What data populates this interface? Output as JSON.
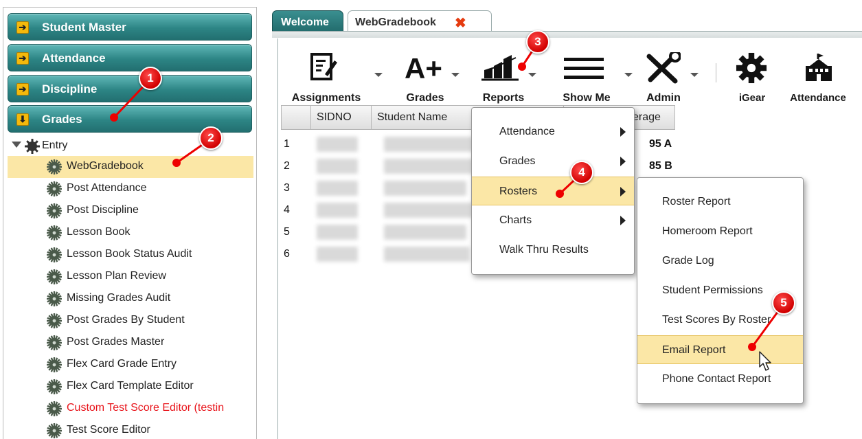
{
  "left_panel": {
    "modules": [
      {
        "label": "Student Master",
        "icon": "arrow-right-icon"
      },
      {
        "label": "Attendance",
        "icon": "arrow-right-icon"
      },
      {
        "label": "Discipline",
        "icon": "arrow-right-icon"
      },
      {
        "label": "Grades",
        "icon": "arrow-down-icon"
      }
    ],
    "tree_root": "Entry",
    "tree_items": [
      "WebGradebook",
      "Post Attendance",
      "Post Discipline",
      "Lesson Book",
      "Lesson Book Status Audit",
      "Lesson Plan Review",
      "Missing Grades Audit",
      "Post Grades By Student",
      "Post Grades Master",
      "Flex Card Grade Entry",
      "Flex Card Template Editor",
      "Custom Test Score Editor (testin",
      "Test Score Editor"
    ],
    "selected_item": "WebGradebook",
    "red_item": "Custom Test Score Editor (testin"
  },
  "tabs": {
    "welcome": "Welcome",
    "webgradebook": "WebGradebook"
  },
  "toolbar": {
    "assignments": "Assignments",
    "grades": "Grades",
    "reports": "Reports",
    "show_me": "Show Me",
    "admin": "Admin",
    "igear": "iGear",
    "attendance": "Attendance"
  },
  "grid": {
    "columns": [
      "SIDNO",
      "Student Name",
      "erage"
    ],
    "rows": [
      {
        "num": "1",
        "average": "95 A"
      },
      {
        "num": "2",
        "average": "85 B"
      },
      {
        "num": "3",
        "average": ""
      },
      {
        "num": "4",
        "average": ""
      },
      {
        "num": "5",
        "average": ""
      },
      {
        "num": "6",
        "average": ""
      }
    ]
  },
  "reports_menu": [
    "Attendance",
    "Grades",
    "Rosters",
    "Charts",
    "Walk Thru Results"
  ],
  "rosters_submenu": [
    "Roster Report",
    "Homeroom Report",
    "Grade Log",
    "Student Permissions",
    "Test Scores By Roster",
    "Email Report",
    "Phone Contact Report"
  ],
  "step_markers": [
    "1",
    "2",
    "3",
    "4",
    "5"
  ],
  "colors": {
    "module_teal": "#2d8585",
    "highlight": "#fbe7a6",
    "marker_red": "#d10000",
    "red_text": "#e8141b"
  }
}
